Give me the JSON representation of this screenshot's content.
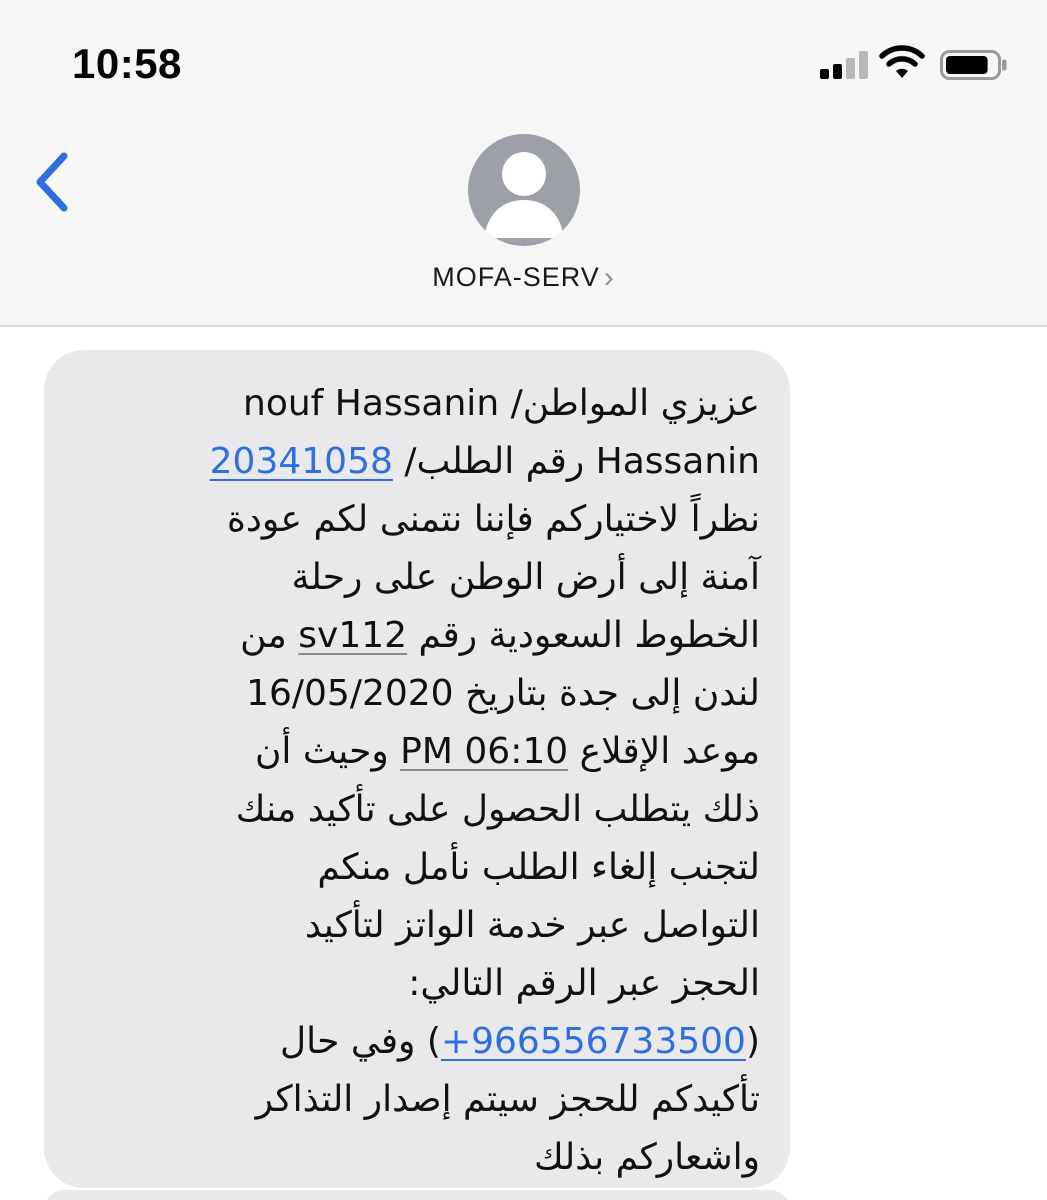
{
  "status_bar": {
    "time": "10:58",
    "signal_bars_active": 2,
    "battery_level": 0.85
  },
  "header": {
    "contact_name": "MOFA-SERV",
    "chevron": "›",
    "back_icon": "chevron-left-icon",
    "avatar_icon": "person-silhouette-icon"
  },
  "colors": {
    "accent": "#2d6fe0",
    "bubble": "#e9e9eb",
    "header_bg": "#f6f6f6"
  },
  "message": {
    "l1": "عزيزي المواطن/ nouf Hassanin",
    "l2_pre": "Hassanin رقم الطلب/ ",
    "l2_link": "20341058",
    "l3": "نظراً لاختياركم فإننا نتمنى لكم عودة",
    "l4": "آمنة إلى أرض الوطن على رحلة",
    "l5_pre": "الخطوط السعودية رقم ",
    "l5_ul": "sv112",
    "l5_post": " من",
    "l6_pre": "لندن إلى جدة بتاريخ ",
    "l6_date": "16/05/2020",
    "l7_pre": "موعد الإقلاع ",
    "l7_ul": "06:10 PM",
    "l7_post": " وحيث أن",
    "l8": "ذلك يتطلب الحصول على تأكيد منك",
    "l9": "لتجنب إلغاء الطلب نأمل منكم",
    "l10": "التواصل عبر خدمة الواتز لتأكيد",
    "l11": "الحجز عبر الرقم التالي:",
    "l12_open": "(",
    "l12_link": "+966556733500",
    "l12_close": ")",
    "l12_post": " وفي حال",
    "l13": "تأكيدكم للحجز سيتم إصدار التذاكر",
    "l14": "واشعاركم بذلك"
  }
}
